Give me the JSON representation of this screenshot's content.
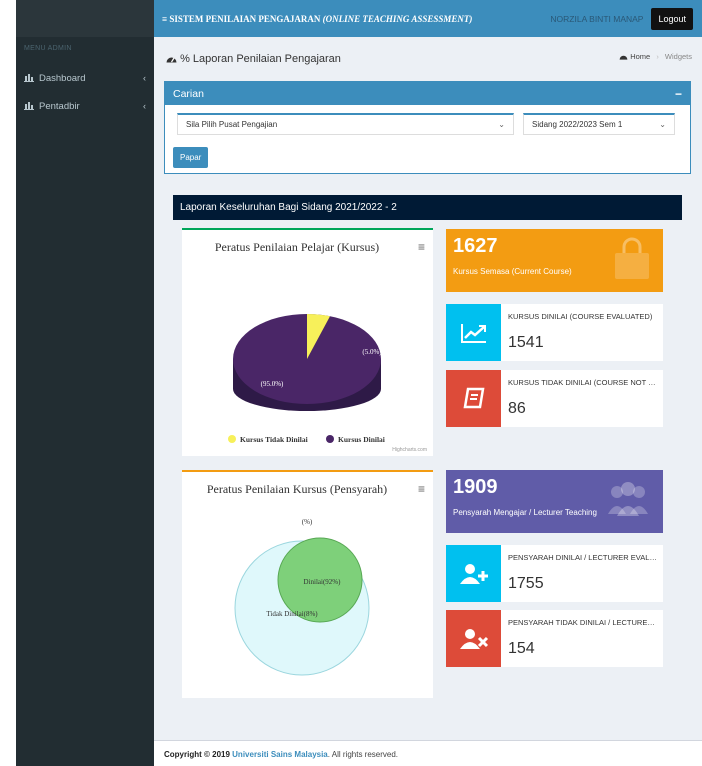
{
  "topbar": {
    "title_main": "SISTEM PENILAIAN PENGAJARAN",
    "title_italic": "(ONLINE TEACHING ASSESSMENT)",
    "user": "NORZILA BINTI MANAP",
    "logout": "Logout"
  },
  "sidebar": {
    "header": "MENU ADMIN",
    "items": [
      {
        "label": "Dashboard",
        "icon": "bar-chart-icon"
      },
      {
        "label": "Pentadbir",
        "icon": "bar-chart-icon"
      }
    ]
  },
  "page": {
    "title": "% Laporan Penilaian Pengajaran",
    "breadcrumb_home": "Home",
    "breadcrumb_current": "Widgets"
  },
  "search": {
    "title": "Carian",
    "centre_select": "Sila Pilih Pusat Pengajian",
    "session_select": "Sidang 2022/2023 Sem 1",
    "button": "Papar"
  },
  "report": {
    "title": "Laporan Keseluruhan Bagi Sidang 2021/2022 - 2"
  },
  "charts": {
    "course": {
      "title": "Peratus Penilaian Pelajar (Kursus)",
      "slice_small_label": "(5.0%)",
      "slice_big_label": "(95.0%)",
      "legend_a": "Kursus Tidak Dinilai",
      "legend_b": "Kursus Dinilai",
      "credits": "Highcharts.com",
      "color_a": "#f7f05a",
      "color_b": "#4a2667"
    },
    "lecturer": {
      "title": "Peratus Penilaian Kursus (Pensyarah)",
      "top_label": "(%)",
      "inner_label": "Dinilai(92%)",
      "outer_label": "Tidak Dinilai(8%)",
      "inner_color": "#7ed07a",
      "outer_color": "#dff8fb"
    }
  },
  "chart_data": [
    {
      "type": "pie",
      "title": "Peratus Penilaian Pelajar (Kursus)",
      "categories": [
        "Kursus Tidak Dinilai",
        "Kursus Dinilai"
      ],
      "values": [
        5.0,
        95.0
      ]
    },
    {
      "type": "pie",
      "title": "Peratus Penilaian Kursus (Pensyarah)",
      "categories": [
        "Dinilai",
        "Tidak Dinilai"
      ],
      "values": [
        92,
        8
      ]
    }
  ],
  "stats": {
    "current_courses": {
      "value": "1627",
      "label": "Kursus Semasa (Current Course)",
      "color": "#f39c12"
    },
    "courses_evaluated": {
      "value": "1541",
      "label": "KURSUS DINILAI (COURSE EVALUATED)",
      "color": "#00c0ef"
    },
    "courses_not_evaluated": {
      "value": "86",
      "label": "KURSUS TIDAK DINILAI (COURSE NOT EVALUATED)",
      "color": "#dd4b39"
    },
    "lecturers_teaching": {
      "value": "1909",
      "label": "Pensyarah Mengajar / Lecturer Teaching",
      "color": "#605ca8"
    },
    "lecturers_evaluated": {
      "value": "1755",
      "label": "PENSYARAH DINILAI / LECTURER EVALUATED",
      "color": "#00c0ef"
    },
    "lecturers_not_evaluated": {
      "value": "154",
      "label": "PENSYARAH TIDAK DINILAI / LECTURER NOT EVALUATED",
      "color": "#dd4b39"
    }
  },
  "footer": {
    "prefix": "Copyright © 2019",
    "org": "Universiti Sains Malaysia",
    "suffix": ". All rights reserved."
  }
}
